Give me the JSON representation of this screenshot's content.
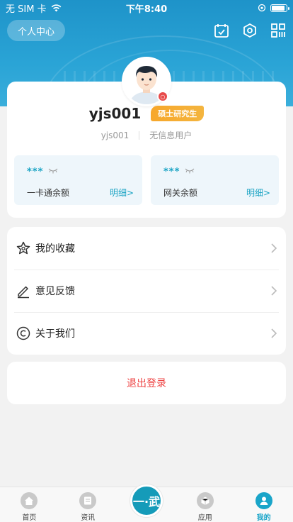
{
  "status_bar": {
    "carrier": "无 SIM 卡",
    "time": "下午8:40",
    "battery_level": 0.8
  },
  "header": {
    "center_button": "个人中心",
    "icons": [
      "calendar-icon",
      "settings-hex-icon",
      "qrcode-icon"
    ]
  },
  "profile": {
    "username": "yjs001",
    "role_tag": "硕士研究生",
    "account_id": "yjs001",
    "user_type": "无信息用户"
  },
  "balances": [
    {
      "hidden_value": "***",
      "label": "一卡通余额",
      "detail": "明细>"
    },
    {
      "hidden_value": "***",
      "label": "网关余额",
      "detail": "明细>"
    }
  ],
  "menu": [
    {
      "icon": "star-icon",
      "label": "我的收藏"
    },
    {
      "icon": "edit-icon",
      "label": "意见反馈"
    },
    {
      "icon": "copyright-icon",
      "label": "关于我们"
    }
  ],
  "logout_label": "退出登录",
  "tabbar": {
    "items": [
      {
        "label": "首页",
        "icon": "home-icon"
      },
      {
        "label": "资讯",
        "icon": "news-icon"
      },
      {
        "label": "",
        "icon": "center-logo-icon"
      },
      {
        "label": "应用",
        "icon": "apps-icon"
      },
      {
        "label": "我的",
        "icon": "profile-icon"
      }
    ],
    "center_logo_text": "一·武",
    "active_index": 4
  },
  "colors": {
    "accent": "#1aa5c9",
    "header": "#2aa4d6",
    "tag": "#f7a72b",
    "danger": "#e44444"
  }
}
